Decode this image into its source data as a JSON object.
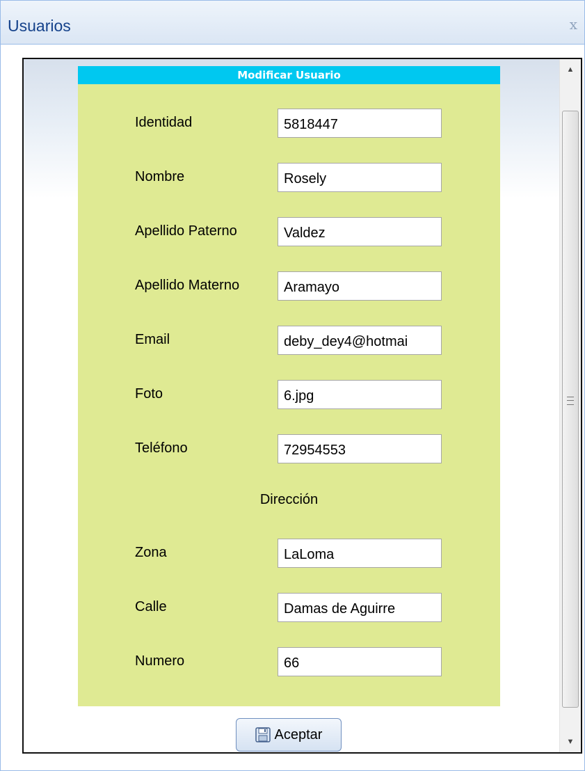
{
  "window": {
    "title": "Usuarios",
    "close_label": "x"
  },
  "form": {
    "header": "Modificar Usuario",
    "fields": [
      {
        "label": "Identidad",
        "value": "5818447"
      },
      {
        "label": "Nombre",
        "value": "Rosely"
      },
      {
        "label": "Apellido Paterno",
        "value": "Valdez"
      },
      {
        "label": "Apellido Materno",
        "value": "Aramayo"
      },
      {
        "label": "Email",
        "value": "deby_dey4@hotmai"
      },
      {
        "label": "Foto",
        "value": "6.jpg"
      },
      {
        "label": "Teléfono",
        "value": "72954553"
      }
    ],
    "section_title": "Dirección",
    "address_fields": [
      {
        "label": "Zona",
        "value": "LaLoma"
      },
      {
        "label": "Calle",
        "value": "Damas de Aguirre"
      },
      {
        "label": "Numero",
        "value": "66"
      }
    ],
    "accept_label": "Aceptar",
    "accept_icon": "save-icon"
  },
  "colors": {
    "form_bg": "#dfea93",
    "header_bg": "#00c8f0",
    "title_color": "#15428b"
  }
}
